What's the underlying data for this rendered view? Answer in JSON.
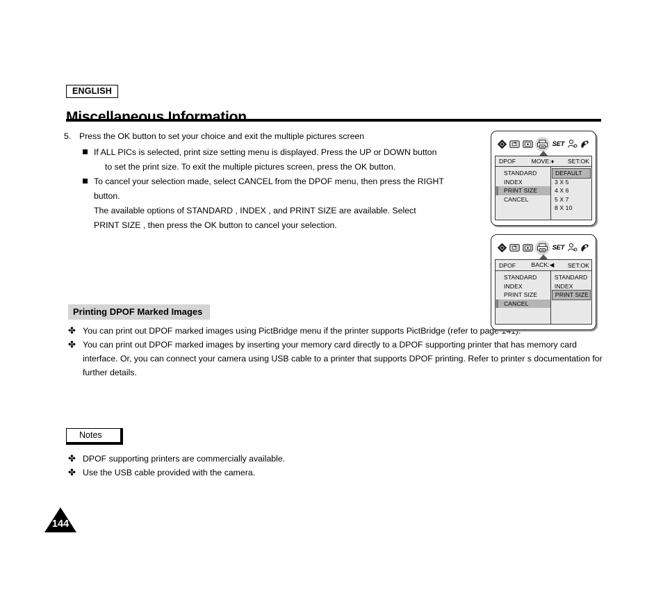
{
  "header": {
    "language_badge": "ENGLISH",
    "title": "Miscellaneous Information"
  },
  "body": {
    "step_number": "5.",
    "step_text": "Press the OK button to set your choice and exit the multiple pictures screen",
    "sub_items": [
      {
        "line1": "If  ALL PICs  is selected, print size setting menu is displayed. Press the UP or DOWN button",
        "line2": "to set the print size. To exit the multiple pictures screen, press the OK button."
      },
      {
        "line1": "To cancel your selection made, select  CANCEL  from the DPOF menu, then press the RIGHT",
        "line2": "button."
      }
    ],
    "paragraphs": [
      "The available options of  STANDARD ,  INDEX , and  PRINT SIZE  are available. Select",
      " PRINT SIZE , then press the OK button to cancel your selection."
    ]
  },
  "section": {
    "heading": "Printing DPOF Marked Images",
    "bullet_mark": "✤",
    "items": [
      "You can print out DPOF marked images using PictBridge menu if the printer supports PictBridge (refer to page 141).",
      "You can print out DPOF marked images by inserting your memory card directly to a DPOF supporting printer that has memory card interface. Or, you can connect your camera using USB cable to a printer that supports DPOF printing. Refer to printer s documentation for further details."
    ]
  },
  "notes": {
    "label": "Notes",
    "bullet_mark": "✤",
    "items": [
      "DPOF supporting printers are commercially available.",
      "Use the USB cable provided with the camera."
    ]
  },
  "page_number": "144",
  "screens": [
    {
      "icons": [
        "move-diamond-icon",
        "playback-icon",
        "photo-icon",
        "printer-icon",
        "set-label",
        "user-icon",
        "settings-icon"
      ],
      "set_label": "SET",
      "menu": {
        "title": "DPOF",
        "nav_label": "MOVE:",
        "nav_symbol": "♦",
        "confirm_label": "SET:OK",
        "left_items": [
          {
            "label": "STANDARD",
            "selected": false
          },
          {
            "label": "INDEX",
            "selected": false
          },
          {
            "label": "PRINT SIZE",
            "selected": true
          },
          {
            "label": "CANCEL",
            "selected": false
          }
        ],
        "right_items": [
          {
            "label": "DEFAULT",
            "selected": true
          },
          {
            "label": "3 X 5",
            "selected": false
          },
          {
            "label": "4 X 6",
            "selected": false
          },
          {
            "label": "5 X 7",
            "selected": false
          },
          {
            "label": "8 X 10",
            "selected": false
          }
        ]
      }
    },
    {
      "icons": [
        "move-diamond-icon",
        "playback-icon",
        "photo-icon",
        "printer-icon",
        "set-label",
        "user-icon",
        "settings-icon"
      ],
      "set_label": "SET",
      "menu": {
        "title": "DPOF",
        "nav_label": "BACK:",
        "nav_symbol": "◀",
        "confirm_label": "SET:OK",
        "left_items": [
          {
            "label": "STANDARD",
            "selected": false
          },
          {
            "label": "INDEX",
            "selected": false
          },
          {
            "label": "PRINT SIZE",
            "selected": false
          },
          {
            "label": "CANCEL",
            "selected": true
          }
        ],
        "right_items": [
          {
            "label": "STANDARD",
            "selected": false
          },
          {
            "label": "INDEX",
            "selected": false
          },
          {
            "label": "PRINT SIZE",
            "selected": true
          }
        ]
      }
    }
  ],
  "colors": {
    "highlight": "#b5b5b5",
    "panel_bg": "#e8e8e8",
    "heading_bg": "#d4d4d4",
    "rule": "#000000"
  }
}
